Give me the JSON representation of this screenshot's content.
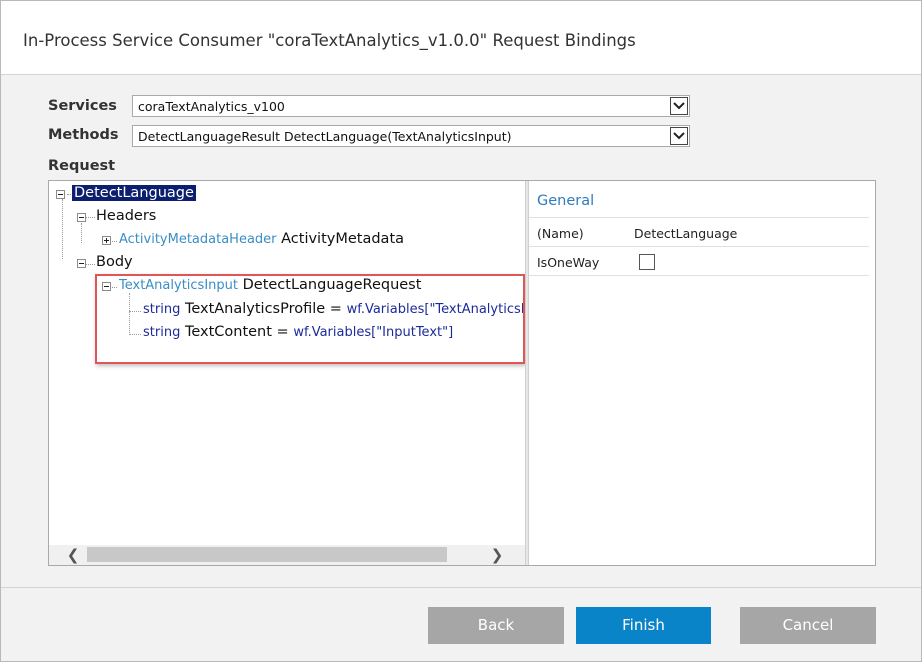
{
  "window": {
    "title": "In-Process Service Consumer \"coraTextAnalytics_v1.0.0\" Request Bindings"
  },
  "form": {
    "services_label": "Services",
    "services_value": "coraTextAnalytics_v100",
    "methods_label": "Methods",
    "methods_value": "DetectLanguageResult DetectLanguage(TextAnalyticsInput)",
    "request_label": "Request"
  },
  "tree": {
    "root": "DetectLanguage",
    "headers": "Headers",
    "header_item_type": "ActivityMetadataHeader",
    "header_item_name": "ActivityMetadata",
    "body": "Body",
    "body_item_type": "TextAnalyticsInput",
    "body_item_name": "DetectLanguageRequest",
    "field1_type": "string",
    "field1_name": "TextAnalyticsProfile =",
    "field1_value": "wf.Variables[\"TextAnalyticsProf",
    "field2_type": "string",
    "field2_name": "TextContent =",
    "field2_value": "wf.Variables[\"InputText\"]"
  },
  "properties": {
    "section": "General",
    "rows": [
      {
        "key": "(Name)",
        "value": "DetectLanguage"
      },
      {
        "key": "IsOneWay",
        "value": ""
      }
    ],
    "isoneway_checked": false
  },
  "buttons": {
    "back": "Back",
    "finish": "Finish",
    "cancel": "Cancel"
  },
  "colors": {
    "accent": "#0a84c8",
    "highlight_border": "#e05656",
    "selected_node": "#0b1f6e"
  }
}
